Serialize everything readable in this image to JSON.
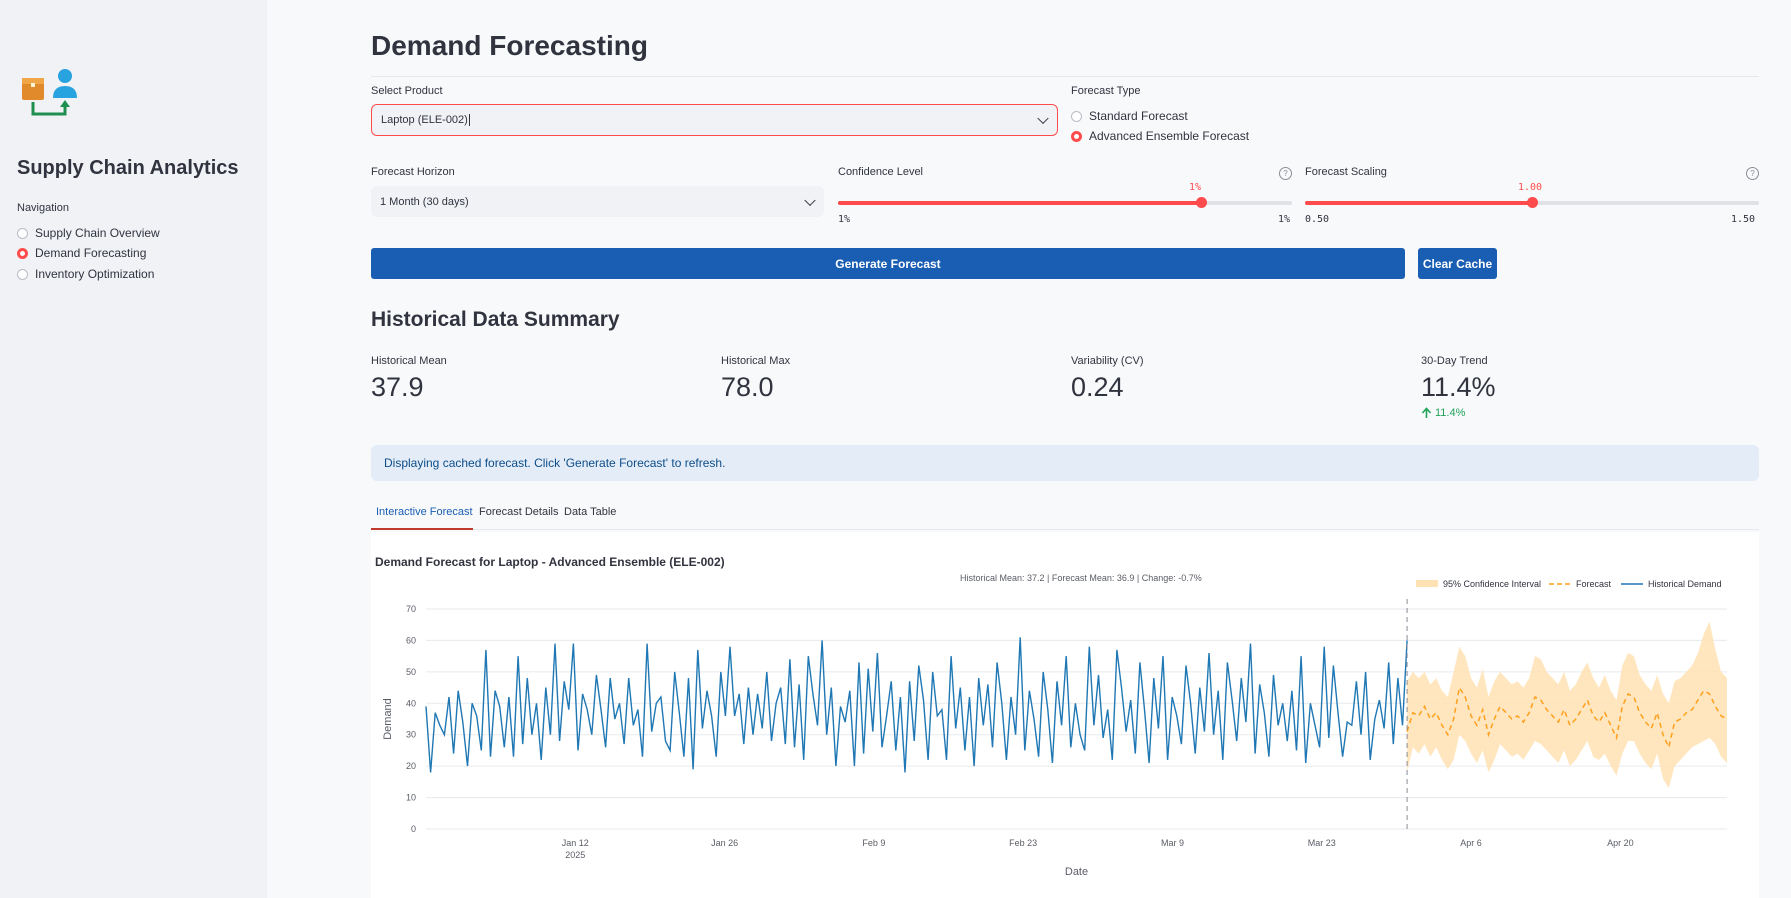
{
  "sidebar": {
    "app_title": "Supply Chain Analytics",
    "nav_label": "Navigation",
    "items": [
      {
        "label": "Supply Chain Overview",
        "selected": false
      },
      {
        "label": "Demand Forecasting",
        "selected": true
      },
      {
        "label": "Inventory Optimization",
        "selected": false
      }
    ]
  },
  "page": {
    "title": "Demand Forecasting"
  },
  "controls": {
    "product": {
      "label": "Select Product",
      "value": "Laptop (ELE-002)"
    },
    "forecast_type": {
      "label": "Forecast Type",
      "options": [
        "Standard Forecast",
        "Advanced Ensemble Forecast"
      ],
      "selected": "Advanced Ensemble Forecast"
    },
    "horizon": {
      "label": "Forecast Horizon",
      "value": "1 Month (30 days)"
    },
    "confidence": {
      "label": "Confidence Level",
      "value_label": "1%",
      "min_label": "1%",
      "max_label": "1%",
      "fraction": 0.8
    },
    "scaling": {
      "label": "Forecast Scaling",
      "value_label": "1.00",
      "min_label": "0.50",
      "max_label": "1.50",
      "value": 1.0,
      "min": 0.5,
      "max": 1.5
    },
    "generate_label": "Generate Forecast",
    "clear_label": "Clear Cache"
  },
  "summary": {
    "heading": "Historical Data Summary",
    "metrics": [
      {
        "label": "Historical Mean",
        "value": "37.9"
      },
      {
        "label": "Historical Max",
        "value": "78.0"
      },
      {
        "label": "Variability (CV)",
        "value": "0.24"
      },
      {
        "label": "30-Day Trend",
        "value": "11.4%",
        "delta": "11.4%"
      }
    ]
  },
  "info_message": "Displaying cached forecast. Click 'Generate Forecast' to refresh.",
  "tabs": [
    {
      "label": "Interactive Forecast",
      "active": true
    },
    {
      "label": "Forecast Details",
      "active": false
    },
    {
      "label": "Data Table",
      "active": false
    }
  ],
  "colors": {
    "accent": "#ff4b4b",
    "primary_button": "#1a5eb3",
    "historical": "#1f77b4",
    "forecast": "#ff9f1c",
    "ci": "#ffe2b3"
  },
  "chart_data": {
    "type": "line",
    "title": "Demand Forecast for Laptop - Advanced Ensemble (ELE-002)",
    "subtitle": "Historical Mean: 37.2 | Forecast Mean: 36.9 | Change: -0.7%",
    "xlabel": "Date",
    "ylabel": "Demand",
    "ylim": [
      0,
      70
    ],
    "yticks": [
      0,
      10,
      20,
      30,
      40,
      50,
      60,
      70
    ],
    "xticks": [
      {
        "date": "2025-01-12",
        "label": "Jan 12",
        "sublabel": "2025"
      },
      {
        "date": "2025-01-26",
        "label": "Jan 26",
        "sublabel": ""
      },
      {
        "date": "2025-02-09",
        "label": "Feb 9",
        "sublabel": ""
      },
      {
        "date": "2025-02-23",
        "label": "Feb 23",
        "sublabel": ""
      },
      {
        "date": "2025-03-09",
        "label": "Mar 9",
        "sublabel": ""
      },
      {
        "date": "2025-03-23",
        "label": "Mar 23",
        "sublabel": ""
      },
      {
        "date": "2025-04-06",
        "label": "Apr 6",
        "sublabel": ""
      },
      {
        "date": "2025-04-20",
        "label": "Apr 20",
        "sublabel": ""
      }
    ],
    "legend": {
      "placement": "top-right",
      "entries": [
        "95% Confidence Interval",
        "Forecast",
        "Historical Demand"
      ]
    },
    "grid": true,
    "historical": {
      "name": "Historical Demand",
      "start_date": "2024-12-29",
      "end_date": "2025-03-31",
      "values": [
        39,
        18,
        37,
        33,
        30,
        42,
        24,
        44,
        34,
        20,
        40,
        36,
        25,
        57,
        23,
        44,
        39,
        26,
        42,
        23,
        55,
        27,
        48,
        30,
        40,
        22,
        45,
        30,
        59,
        28,
        47,
        38,
        59,
        25,
        43,
        38,
        30,
        49,
        38,
        26,
        48,
        35,
        40,
        27,
        48,
        33,
        38,
        23,
        59,
        31,
        40,
        42,
        28,
        25,
        50,
        37,
        23,
        48,
        19,
        57,
        32,
        44,
        36,
        23,
        50,
        36,
        58,
        36,
        43,
        27,
        45,
        30,
        43,
        32,
        50,
        28,
        40,
        45,
        27,
        54,
        26,
        46,
        22,
        55,
        43,
        33,
        60,
        30,
        45,
        20,
        39,
        34,
        44,
        20,
        53,
        24,
        51,
        31,
        56,
        26,
        36,
        47,
        25,
        42,
        18,
        47,
        28,
        52,
        41,
        22,
        50,
        36,
        38,
        22,
        55,
        32,
        45,
        25,
        42,
        20,
        48,
        33,
        46,
        26,
        53,
        40,
        22,
        42,
        30,
        61,
        25,
        44,
        35,
        23,
        50,
        38,
        21,
        47,
        33,
        55,
        26,
        40,
        30,
        25,
        58,
        33,
        49,
        29,
        38,
        22,
        57,
        45,
        31,
        41,
        24,
        53,
        38,
        21,
        48,
        32,
        55,
        22,
        42,
        36,
        27,
        52,
        40,
        24,
        45,
        31,
        56,
        30,
        44,
        22,
        53,
        41,
        28,
        48,
        34,
        59,
        24,
        46,
        37,
        23,
        49,
        33,
        40,
        28,
        44,
        25,
        55,
        21,
        40,
        33,
        26,
        58,
        29,
        52,
        37,
        23,
        34,
        33,
        47,
        30,
        50,
        22,
        35,
        41,
        32,
        53,
        27,
        48,
        33,
        60
      ],
      "note": ""
    },
    "forecast": {
      "name": "Forecast",
      "start_date": "2025-03-31",
      "end_date": "2025-04-30",
      "values": [
        31,
        37,
        36,
        39,
        35,
        37,
        33,
        30,
        35,
        45,
        42,
        36,
        33,
        38,
        30,
        35,
        39,
        37,
        35,
        36,
        34,
        37,
        42,
        41,
        38,
        36,
        34,
        38,
        33,
        35,
        38,
        41,
        36,
        34,
        37,
        33,
        29,
        39,
        43,
        42,
        37,
        34,
        32,
        37,
        30,
        26,
        34,
        35,
        37,
        38,
        41,
        44,
        43,
        39,
        36,
        35
      ],
      "ci_upper": [
        47,
        50,
        48,
        50,
        46,
        48,
        44,
        42,
        50,
        58,
        55,
        48,
        45,
        51,
        42,
        47,
        50,
        48,
        46,
        47,
        45,
        48,
        55,
        54,
        50,
        48,
        46,
        50,
        44,
        46,
        50,
        53,
        48,
        45,
        49,
        44,
        41,
        52,
        56,
        55,
        49,
        46,
        44,
        49,
        43,
        40,
        47,
        48,
        50,
        52,
        56,
        62,
        66,
        57,
        50,
        48
      ],
      "ci_lower": [
        18,
        26,
        24,
        27,
        23,
        26,
        22,
        19,
        22,
        30,
        28,
        24,
        21,
        25,
        18,
        22,
        27,
        25,
        23,
        24,
        22,
        25,
        28,
        27,
        25,
        23,
        21,
        25,
        20,
        22,
        25,
        28,
        23,
        22,
        24,
        20,
        17,
        24,
        28,
        28,
        24,
        21,
        19,
        24,
        16,
        13,
        20,
        22,
        24,
        26,
        27,
        28,
        29,
        27,
        23,
        21
      ]
    }
  }
}
